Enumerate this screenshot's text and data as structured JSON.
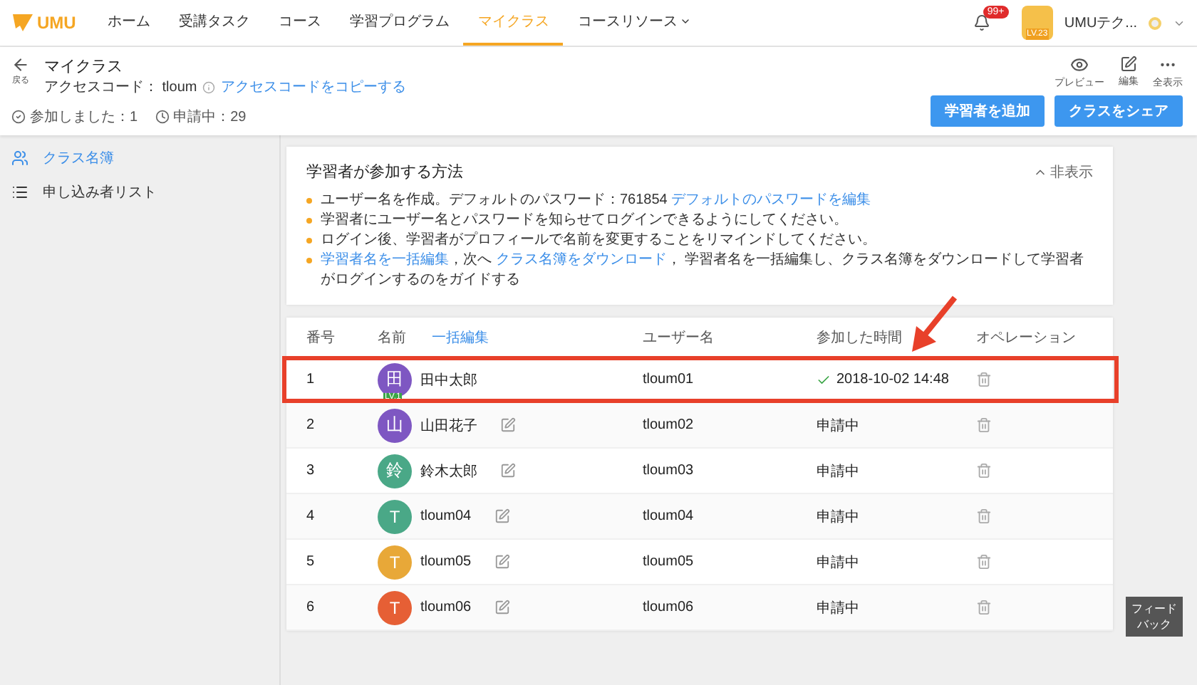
{
  "nav": {
    "logo": "UMU",
    "items": [
      {
        "label": "ホーム",
        "selected": false,
        "dropdown": false
      },
      {
        "label": "受講タスク",
        "selected": false,
        "dropdown": false
      },
      {
        "label": "コース",
        "selected": false,
        "dropdown": false
      },
      {
        "label": "学習プログラム",
        "selected": false,
        "dropdown": false
      },
      {
        "label": "マイクラス",
        "selected": true,
        "dropdown": false
      },
      {
        "label": "コースリソース",
        "selected": false,
        "dropdown": true
      }
    ],
    "notification_badge": "99+",
    "user": {
      "level": "LV.23",
      "name": "UMUテク..."
    }
  },
  "header": {
    "back_label": "戻る",
    "title": "マイクラス",
    "access_code_label": "アクセスコード：",
    "access_code": "tloum",
    "copy_link": "アクセスコードをコピーする",
    "stats": [
      {
        "kind": "joined",
        "label": "参加しました：1"
      },
      {
        "kind": "pending",
        "label": "申請中：29"
      }
    ],
    "actions": [
      {
        "kind": "preview",
        "label": "プレビュー"
      },
      {
        "kind": "edit",
        "label": "編集"
      },
      {
        "kind": "more",
        "label": "全表示"
      }
    ],
    "buttons": [
      "学習者を追加",
      "クラスをシェア"
    ]
  },
  "sidebar": {
    "items": [
      {
        "kind": "roster",
        "label": "クラス名簿",
        "selected": true
      },
      {
        "kind": "list",
        "label": "申し込み者リスト",
        "selected": false
      }
    ]
  },
  "instructions": {
    "title": "学習者が参加する方法",
    "toggle": "非表示",
    "expanded": true,
    "items": [
      [
        {
          "text": "ユーザー名を作成。デフォルトのパスワード：761854 ",
          "link": false
        },
        {
          "text": "デフォルトのパスワードを編集",
          "link": true
        }
      ],
      [
        {
          "text": "学習者にユーザー名とパスワードを知らせてログインできるようにしてください。",
          "link": false
        }
      ],
      [
        {
          "text": "ログイン後、学習者がプロフィールで名前を変更することをリマインドしてください。",
          "link": false
        }
      ],
      [
        {
          "text": "学習者名を一括編集",
          "link": true
        },
        {
          "text": "，次へ ",
          "link": false
        },
        {
          "text": "クラス名簿をダウンロード",
          "link": true
        },
        {
          "text": "， 学習者名を一括編集し、クラス名簿をダウンロードして学習者がログインするのをガイドする",
          "link": false
        }
      ]
    ]
  },
  "table": {
    "columns": [
      "番号",
      "名前",
      "ユーザー名",
      "参加した時間",
      "オペレーション"
    ],
    "bulk_edit": "一括編集",
    "rows": [
      {
        "number": "1",
        "avatar": "田",
        "color": "#7e57c2",
        "level": "LV.1",
        "name": "田中太郎",
        "editable": false,
        "username": "tloum01",
        "joined": true,
        "time": "2018-10-02 14:48",
        "highlighted": true
      },
      {
        "number": "2",
        "avatar": "山",
        "color": "#7e57c2",
        "name": "山田花子",
        "editable": true,
        "username": "tloum02",
        "joined": false,
        "time": "申請中",
        "highlighted": false
      },
      {
        "number": "3",
        "avatar": "鈴",
        "color": "#4aa887",
        "name": "鈴木太郎",
        "editable": true,
        "username": "tloum03",
        "joined": false,
        "time": "申請中",
        "highlighted": false
      },
      {
        "number": "4",
        "avatar": "T",
        "color": "#4aa887",
        "name": "tloum04",
        "editable": true,
        "username": "tloum04",
        "joined": false,
        "time": "申請中",
        "highlighted": false
      },
      {
        "number": "5",
        "avatar": "T",
        "color": "#e8a838",
        "name": "tloum05",
        "editable": true,
        "username": "tloum05",
        "joined": false,
        "time": "申請中",
        "highlighted": false
      },
      {
        "number": "6",
        "avatar": "T",
        "color": "#e65f35",
        "name": "tloum06",
        "editable": true,
        "username": "tloum06",
        "joined": false,
        "time": "申請中",
        "highlighted": false
      }
    ]
  },
  "feedback": "フィードバック"
}
